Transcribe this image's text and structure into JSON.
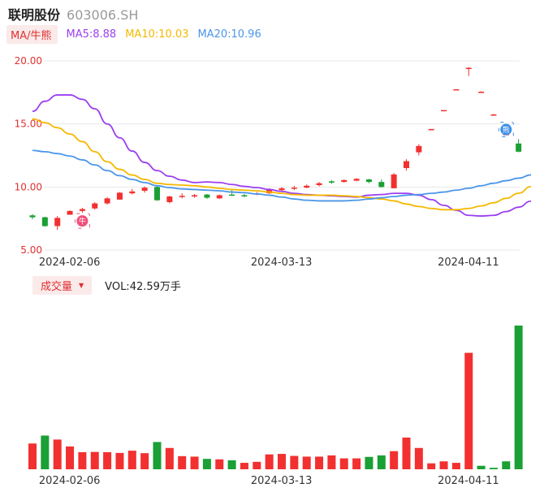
{
  "header": {
    "name": "联明股份",
    "code": "603006.SH"
  },
  "ma_legend": {
    "button": "MA/牛熊",
    "items": [
      {
        "label": "MA5:8.88",
        "color": "#9b3ff0"
      },
      {
        "label": "MA10:10.03",
        "color": "#f5b800"
      },
      {
        "label": "MA20:10.96",
        "color": "#4a96e8"
      }
    ]
  },
  "volume_legend": {
    "button": "成交量",
    "caret": "▼",
    "value": "VOL:42.59万手"
  },
  "colors": {
    "up": "#f23030",
    "down": "#1aa034",
    "axis_text": "#e03030",
    "date_text": "#333333",
    "grid": "#e8e8e8"
  },
  "markers": [
    {
      "icon": "bull-icon",
      "glyph": "牛",
      "index": 4,
      "color": "#f0507a"
    },
    {
      "icon": "bear-icon",
      "glyph": "熊",
      "index": 38,
      "color": "#3a8ee8"
    }
  ],
  "chart_data": [
    {
      "type": "candlestick",
      "ylim": [
        5,
        20
      ],
      "y_ticks": [
        "20.00",
        "15.00",
        "10.00",
        "5.00"
      ],
      "x_tick_labels": [
        {
          "index": 2,
          "label": "2024-02-06"
        },
        {
          "index": 19,
          "label": "2024-03-13"
        },
        {
          "index": 34,
          "label": "2024-04-11"
        }
      ],
      "ohlc": [
        [
          7.75,
          7.85,
          7.45,
          7.6
        ],
        [
          7.6,
          7.65,
          6.85,
          6.9
        ],
        [
          6.9,
          7.7,
          6.6,
          7.55
        ],
        [
          7.8,
          8.15,
          7.8,
          8.1
        ],
        [
          8.1,
          8.35,
          7.95,
          8.25
        ],
        [
          8.3,
          8.8,
          8.2,
          8.7
        ],
        [
          8.7,
          9.2,
          8.6,
          9.1
        ],
        [
          9.0,
          9.6,
          9.0,
          9.55
        ],
        [
          9.5,
          9.85,
          9.4,
          9.65
        ],
        [
          9.7,
          10.05,
          9.55,
          9.95
        ],
        [
          10.0,
          10.1,
          8.9,
          8.95
        ],
        [
          8.8,
          9.3,
          8.7,
          9.25
        ],
        [
          9.25,
          9.5,
          9.1,
          9.3
        ],
        [
          9.25,
          9.45,
          9.15,
          9.35
        ],
        [
          9.4,
          9.45,
          9.05,
          9.15
        ],
        [
          9.1,
          9.4,
          9.05,
          9.35
        ],
        [
          9.4,
          9.75,
          9.3,
          9.35
        ],
        [
          9.35,
          9.45,
          9.2,
          9.3
        ],
        [
          9.4,
          9.6,
          9.35,
          9.5
        ],
        [
          9.5,
          9.9,
          9.45,
          9.8
        ],
        [
          9.75,
          10.0,
          9.7,
          9.9
        ],
        [
          9.9,
          10.1,
          9.75,
          9.95
        ],
        [
          9.95,
          10.2,
          9.9,
          10.1
        ],
        [
          10.15,
          10.4,
          10.05,
          10.3
        ],
        [
          10.45,
          10.55,
          10.25,
          10.35
        ],
        [
          10.4,
          10.6,
          10.35,
          10.55
        ],
        [
          10.5,
          10.7,
          10.45,
          10.65
        ],
        [
          10.6,
          10.65,
          10.3,
          10.4
        ],
        [
          10.4,
          10.6,
          9.95,
          10.0
        ],
        [
          9.9,
          11.1,
          9.9,
          11.0
        ],
        [
          11.5,
          12.2,
          11.3,
          12.05
        ],
        [
          12.75,
          13.4,
          12.5,
          13.25
        ],
        [
          14.5,
          14.6,
          14.5,
          14.6
        ],
        [
          16.05,
          16.1,
          16.05,
          16.1
        ],
        [
          17.7,
          17.75,
          17.7,
          17.75
        ],
        [
          19.45,
          19.5,
          18.8,
          19.45
        ],
        [
          17.55,
          17.6,
          17.55,
          17.55
        ],
        [
          15.75,
          15.8,
          15.75,
          15.75
        ],
        [
          14.2,
          14.3,
          14.15,
          14.2
        ],
        [
          13.45,
          13.8,
          12.75,
          12.8
        ]
      ],
      "series": [
        {
          "name": "MA5",
          "color": "#9b3ff0",
          "values": [
            16.0,
            16.8,
            17.3,
            17.3,
            16.95,
            16.2,
            15.0,
            13.9,
            12.85,
            11.95,
            11.3,
            10.85,
            10.55,
            10.35,
            10.4,
            10.35,
            10.2,
            10.05,
            9.95,
            9.8,
            9.65,
            9.5,
            9.4,
            9.35,
            9.3,
            9.25,
            9.2,
            9.35,
            9.4,
            9.5,
            9.5,
            9.35,
            9.0,
            8.55,
            8.15,
            7.75,
            7.7,
            7.75,
            8.05,
            8.4,
            8.88
          ]
        },
        {
          "name": "MA10",
          "color": "#f5b800",
          "values": [
            15.4,
            15.1,
            14.7,
            14.2,
            13.6,
            12.8,
            12.0,
            11.4,
            10.95,
            10.6,
            10.3,
            10.2,
            10.15,
            10.1,
            10.0,
            9.9,
            9.8,
            9.75,
            9.7,
            9.6,
            9.5,
            9.4,
            9.35,
            9.35,
            9.35,
            9.3,
            9.25,
            9.15,
            9.05,
            8.9,
            8.65,
            8.45,
            8.3,
            8.2,
            8.2,
            8.3,
            8.5,
            8.75,
            9.1,
            9.5,
            10.03
          ]
        },
        {
          "name": "MA20",
          "color": "#4a96e8",
          "values": [
            12.9,
            12.8,
            12.65,
            12.45,
            12.15,
            11.75,
            11.3,
            10.9,
            10.6,
            10.35,
            10.1,
            9.95,
            9.85,
            9.8,
            9.75,
            9.7,
            9.6,
            9.55,
            9.45,
            9.35,
            9.2,
            9.05,
            8.95,
            8.9,
            8.9,
            8.9,
            8.95,
            9.05,
            9.15,
            9.25,
            9.35,
            9.4,
            9.5,
            9.6,
            9.75,
            9.9,
            10.1,
            10.3,
            10.5,
            10.7,
            10.96
          ]
        }
      ]
    },
    {
      "type": "bar",
      "title": "成交量",
      "unit": "万手",
      "ylim": [
        0,
        18
      ],
      "values": [
        10.4,
        13.6,
        12.0,
        9.2,
        6.9,
        7.0,
        6.9,
        6.6,
        7.5,
        6.5,
        11.0,
        8.6,
        5.3,
        5.1,
        4.2,
        4.0,
        3.6,
        2.6,
        3.0,
        6.0,
        6.2,
        5.4,
        5.1,
        5.1,
        5.6,
        4.4,
        4.4,
        5.0,
        5.6,
        7.3,
        12.8,
        8.6,
        2.4,
        3.2,
        2.6,
        47.0,
        1.4,
        0.6,
        3.2,
        58.0
      ],
      "colors": [
        "up",
        "down",
        "up",
        "up",
        "up",
        "up",
        "up",
        "up",
        "up",
        "up",
        "down",
        "up",
        "up",
        "up",
        "down",
        "up",
        "down",
        "up",
        "up",
        "up",
        "up",
        "up",
        "up",
        "up",
        "up",
        "up",
        "up",
        "down",
        "down",
        "up",
        "up",
        "up",
        "up",
        "up",
        "up",
        "up",
        "down",
        "down",
        "down",
        "down"
      ]
    }
  ]
}
